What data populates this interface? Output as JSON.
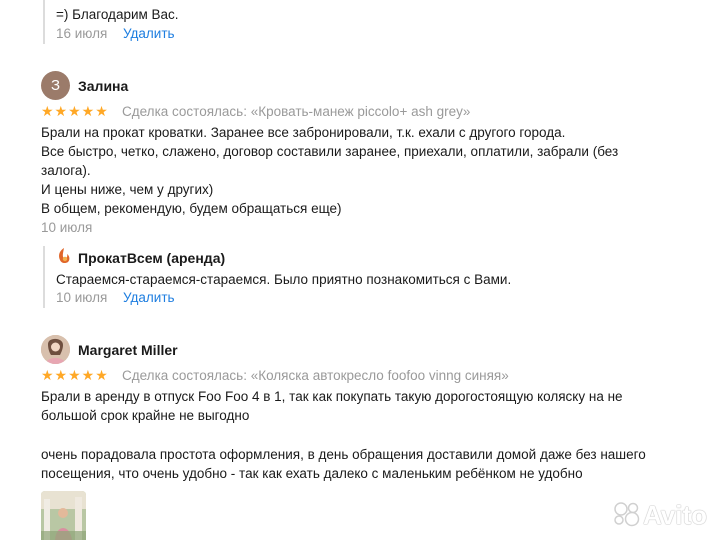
{
  "reply_top": {
    "text": "=) Благодарим Вас.",
    "date": "16 июля",
    "delete_label": "Удалить"
  },
  "review1": {
    "avatar_letter": "З",
    "author": "Залина",
    "stars": "★★★★★",
    "deal": "Сделка состоялась: «Кровать-манеж piccolo+ ash grey»",
    "lines": [
      "Брали на прокат кроватки. Заранее все забронировали, т.к. ехали с другого города.",
      "Все быстро, четко, слажено, договор составили заранее, приехали, оплатили, забрали (без",
      "залога).",
      "И цены ниже, чем у других)",
      "В общем, рекомендую, будем обращаться еще)"
    ],
    "date": "10 июля",
    "reply": {
      "author": "ПрокатВсем (аренда)",
      "text": "Стараемся-стараемся-стараемся. Было приятно познакомиться с Вами.",
      "date": "10 июля",
      "delete_label": "Удалить"
    }
  },
  "review2": {
    "author": "Margaret Miller",
    "stars": "★★★★★",
    "deal": "Сделка состоялась: «Коляска автокресло foofoo vinng синяя»",
    "lines": [
      "Брали в аренду в отпуск Foo Foo 4 в 1, так как покупать такую дорогостоящую коляску на не",
      "большой срок крайне не выгодно",
      "",
      "очень порадовала простота оформления, в день обращения доставили домой даже без нашего",
      "посещения, что очень удобно - так как ехать далеко с маленьким ребёнком не удобно"
    ]
  },
  "watermark": "Avito",
  "colors": {
    "star": "#ffa826",
    "link": "#1e7ee0",
    "muted": "#9a9a9a",
    "avatar_bg": "#9b7b6a"
  }
}
